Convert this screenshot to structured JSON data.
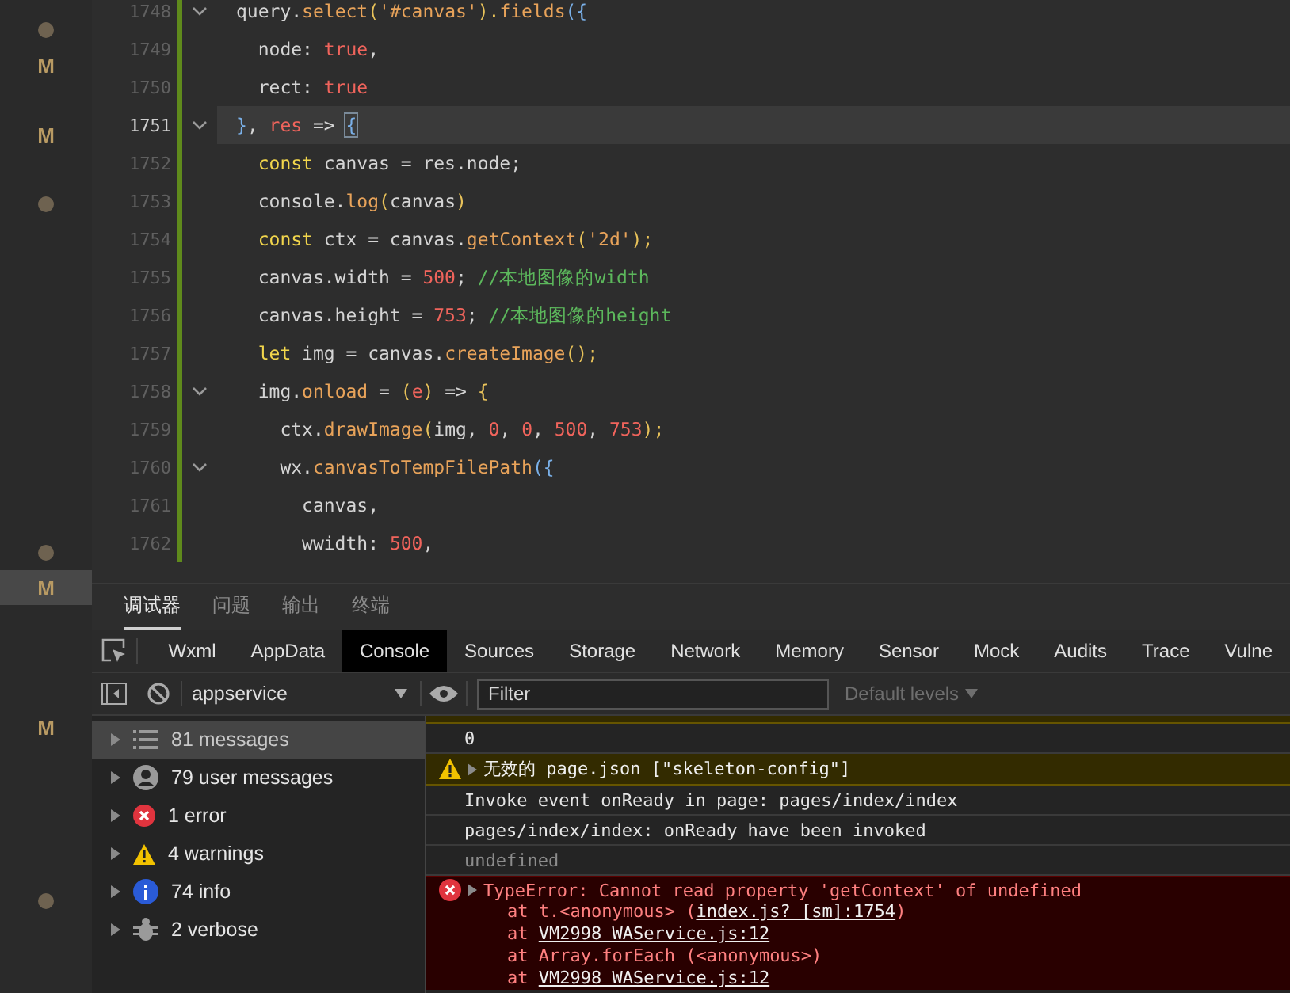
{
  "gutter": [
    {
      "kind": "dot",
      "selected": false
    },
    {
      "kind": "modified",
      "label": "M",
      "selected": false
    },
    {
      "kind": "blank",
      "selected": false
    },
    {
      "kind": "modified",
      "label": "M",
      "selected": false
    },
    {
      "kind": "blank",
      "selected": false
    },
    {
      "kind": "dot",
      "selected": false
    },
    {
      "kind": "blank",
      "selected": false
    },
    {
      "kind": "blank",
      "selected": false
    },
    {
      "kind": "blank",
      "selected": false
    },
    {
      "kind": "blank",
      "selected": false
    },
    {
      "kind": "blank",
      "selected": false
    },
    {
      "kind": "blank",
      "selected": false
    },
    {
      "kind": "blank",
      "selected": false
    },
    {
      "kind": "blank",
      "selected": false
    },
    {
      "kind": "blank",
      "selected": false
    },
    {
      "kind": "dot",
      "selected": false
    },
    {
      "kind": "modified",
      "label": "M",
      "selected": true
    },
    {
      "kind": "blank",
      "selected": false
    },
    {
      "kind": "blank",
      "selected": false
    },
    {
      "kind": "blank",
      "selected": false
    },
    {
      "kind": "modified",
      "label": "M",
      "selected": false
    },
    {
      "kind": "blank",
      "selected": false
    },
    {
      "kind": "blank",
      "selected": false
    },
    {
      "kind": "blank",
      "selected": false
    },
    {
      "kind": "blank",
      "selected": false
    },
    {
      "kind": "dot",
      "selected": false
    }
  ],
  "editor": {
    "lines": [
      {
        "number": "1748",
        "foldable": true,
        "current": false,
        "tokens": [
          {
            "text": "query.",
            "kind": "plain"
          },
          {
            "text": "select",
            "kind": "func"
          },
          {
            "text": "(",
            "kind": "paren"
          },
          {
            "text": "'#canvas'",
            "kind": "string"
          },
          {
            "text": ").",
            "kind": "paren"
          },
          {
            "text": "fields",
            "kind": "func"
          },
          {
            "text": "({",
            "kind": "brace"
          }
        ]
      },
      {
        "number": "1749",
        "foldable": false,
        "current": false,
        "tokens": [
          {
            "text": "  node: ",
            "kind": "plain"
          },
          {
            "text": "true",
            "kind": "literal"
          },
          {
            "text": ",",
            "kind": "plain"
          }
        ]
      },
      {
        "number": "1750",
        "foldable": false,
        "current": false,
        "tokens": [
          {
            "text": "  rect: ",
            "kind": "plain"
          },
          {
            "text": "true",
            "kind": "literal"
          }
        ]
      },
      {
        "number": "1751",
        "foldable": true,
        "current": true,
        "tokens": [
          {
            "text": "}",
            "kind": "brace"
          },
          {
            "text": ", ",
            "kind": "plain"
          },
          {
            "text": "res",
            "kind": "param"
          },
          {
            "text": " => ",
            "kind": "plain"
          },
          {
            "text": "{",
            "kind": "match"
          }
        ]
      },
      {
        "number": "1752",
        "foldable": false,
        "current": false,
        "tokens": [
          {
            "text": "  const",
            "kind": "keyword"
          },
          {
            "text": " canvas = res.node;",
            "kind": "plain"
          }
        ]
      },
      {
        "number": "1753",
        "foldable": false,
        "current": false,
        "tokens": [
          {
            "text": "  console.",
            "kind": "plain"
          },
          {
            "text": "log",
            "kind": "func"
          },
          {
            "text": "(",
            "kind": "paren"
          },
          {
            "text": "canvas",
            "kind": "plain"
          },
          {
            "text": ")",
            "kind": "paren"
          }
        ]
      },
      {
        "number": "1754",
        "foldable": false,
        "current": false,
        "tokens": [
          {
            "text": "  const",
            "kind": "keyword"
          },
          {
            "text": " ctx = canvas.",
            "kind": "plain"
          },
          {
            "text": "getContext",
            "kind": "func"
          },
          {
            "text": "(",
            "kind": "paren"
          },
          {
            "text": "'2d'",
            "kind": "string"
          },
          {
            "text": ");",
            "kind": "paren"
          }
        ]
      },
      {
        "number": "1755",
        "foldable": false,
        "current": false,
        "tokens": [
          {
            "text": "  canvas.width = ",
            "kind": "plain"
          },
          {
            "text": "500",
            "kind": "number"
          },
          {
            "text": "; ",
            "kind": "plain"
          },
          {
            "text": "//本地图像的width",
            "kind": "comment"
          }
        ]
      },
      {
        "number": "1756",
        "foldable": false,
        "current": false,
        "tokens": [
          {
            "text": "  canvas.height = ",
            "kind": "plain"
          },
          {
            "text": "753",
            "kind": "number"
          },
          {
            "text": "; ",
            "kind": "plain"
          },
          {
            "text": "//本地图像的height",
            "kind": "comment"
          }
        ]
      },
      {
        "number": "1757",
        "foldable": false,
        "current": false,
        "tokens": [
          {
            "text": "  let",
            "kind": "keyword"
          },
          {
            "text": " img = canvas.",
            "kind": "plain"
          },
          {
            "text": "createImage",
            "kind": "func"
          },
          {
            "text": "();",
            "kind": "paren"
          }
        ]
      },
      {
        "number": "1758",
        "foldable": true,
        "current": false,
        "tokens": [
          {
            "text": "  img.",
            "kind": "plain"
          },
          {
            "text": "onload",
            "kind": "func"
          },
          {
            "text": " = ",
            "kind": "plain"
          },
          {
            "text": "(",
            "kind": "paren"
          },
          {
            "text": "e",
            "kind": "param"
          },
          {
            "text": ")",
            "kind": "paren"
          },
          {
            "text": " => ",
            "kind": "plain"
          },
          {
            "text": "{",
            "kind": "paren"
          }
        ]
      },
      {
        "number": "1759",
        "foldable": false,
        "current": false,
        "tokens": [
          {
            "text": "    ctx.",
            "kind": "plain"
          },
          {
            "text": "drawImage",
            "kind": "func"
          },
          {
            "text": "(",
            "kind": "paren"
          },
          {
            "text": "img, ",
            "kind": "plain"
          },
          {
            "text": "0",
            "kind": "number"
          },
          {
            "text": ", ",
            "kind": "plain"
          },
          {
            "text": "0",
            "kind": "number"
          },
          {
            "text": ", ",
            "kind": "plain"
          },
          {
            "text": "500",
            "kind": "number"
          },
          {
            "text": ", ",
            "kind": "plain"
          },
          {
            "text": "753",
            "kind": "number"
          },
          {
            "text": ");",
            "kind": "paren"
          }
        ]
      },
      {
        "number": "1760",
        "foldable": true,
        "current": false,
        "tokens": [
          {
            "text": "    wx.",
            "kind": "plain"
          },
          {
            "text": "canvasToTempFilePath",
            "kind": "func"
          },
          {
            "text": "({",
            "kind": "brace"
          }
        ]
      },
      {
        "number": "1761",
        "foldable": false,
        "current": false,
        "tokens": [
          {
            "text": "      canvas,",
            "kind": "plain"
          }
        ]
      },
      {
        "number": "1762",
        "foldable": false,
        "current": false,
        "tokens": [
          {
            "text": "      wwidth: ",
            "kind": "plain"
          },
          {
            "text": "500",
            "kind": "number"
          },
          {
            "text": ",",
            "kind": "plain"
          }
        ]
      }
    ]
  },
  "panel_tabs": [
    {
      "label": "调试器",
      "selected": true
    },
    {
      "label": "问题",
      "selected": false
    },
    {
      "label": "输出",
      "selected": false
    },
    {
      "label": "终端",
      "selected": false
    }
  ],
  "devtools_tabs": [
    {
      "label": "Wxml",
      "selected": false
    },
    {
      "label": "AppData",
      "selected": false
    },
    {
      "label": "Console",
      "selected": true
    },
    {
      "label": "Sources",
      "selected": false
    },
    {
      "label": "Storage",
      "selected": false
    },
    {
      "label": "Network",
      "selected": false
    },
    {
      "label": "Memory",
      "selected": false
    },
    {
      "label": "Sensor",
      "selected": false
    },
    {
      "label": "Mock",
      "selected": false
    },
    {
      "label": "Audits",
      "selected": false
    },
    {
      "label": "Trace",
      "selected": false
    },
    {
      "label": "Vulne",
      "selected": false
    }
  ],
  "console_toolbar": {
    "context": "appservice",
    "filter": {
      "placeholder": "Filter"
    },
    "levels": "Default levels",
    "levels_disabled": true
  },
  "sidebar": {
    "items": [
      {
        "label": "81 messages",
        "kind": "all",
        "selected": true
      },
      {
        "label": "79 user messages",
        "kind": "user",
        "selected": false
      },
      {
        "label": "1 error",
        "kind": "error",
        "selected": false
      },
      {
        "label": "4 warnings",
        "kind": "warning",
        "selected": false
      },
      {
        "label": "74 info",
        "kind": "info",
        "selected": false
      },
      {
        "label": "2 verbose",
        "kind": "verbose",
        "selected": false
      }
    ]
  },
  "messages": [
    {
      "kind": "warning-cut"
    },
    {
      "kind": "log",
      "text": "0"
    },
    {
      "kind": "warning",
      "text": "无效的 page.json [\"skeleton-config\"]"
    },
    {
      "kind": "log",
      "text": "Invoke event onReady in page: pages/index/index"
    },
    {
      "kind": "log",
      "text": "pages/index/index: onReady have been invoked"
    },
    {
      "kind": "result",
      "text": "undefined"
    },
    {
      "kind": "error",
      "text": "TypeError: Cannot read property 'getContext' of undefined",
      "stack": [
        {
          "prefix": "at t.<anonymous> (",
          "link": "index.js? [sm]:1754",
          "suffix": ")"
        },
        {
          "prefix": "at ",
          "link": "VM2998 WAService.js:12"
        },
        {
          "prefix": "at Array.forEach (<anonymous>)"
        },
        {
          "prefix": "at ",
          "link": "VM2998 WAService.js:12"
        }
      ]
    }
  ]
}
